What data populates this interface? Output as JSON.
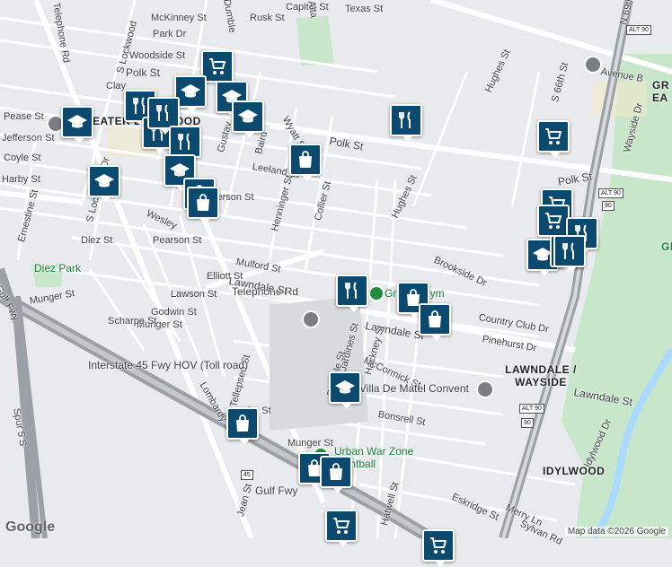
{
  "map": {
    "street_labels": [
      "Telephone Rd",
      "S Lockwood",
      "McKinney St",
      "Rusk St",
      "Capitol St",
      "Texas St",
      "Dumble",
      "Alta",
      "Park Dr",
      "Woodside St",
      "Polk St",
      "Clay",
      "Pease St",
      "Jefferson St",
      "Coyle St",
      "Harby St",
      "Ernestine St",
      "S Lockwood Dr",
      "Diez St",
      "Munger St",
      "Gustav",
      "Baird",
      "Leeland St",
      "Henninger St",
      "Collier St",
      "Wyatt St",
      "Polk St",
      "Polk St",
      "Hughes St",
      "Hughes St",
      "Hughes St",
      "S 66th St",
      "Avenue B",
      "Wayside Dr",
      "Wesley",
      "Jefferson St",
      "Pearson St",
      "Elliott St",
      "Lawson St",
      "Godwin St",
      "Munger St",
      "Scharpe St",
      "Lombardy St",
      "Telephone Rd",
      "Mulford St",
      "Lawndale St",
      "Brookside Dr",
      "Country Club Dr",
      "Pinehurst Dr",
      "Lawndale St",
      "Lawndale St",
      "McCormick St",
      "Bonsrell St",
      "Jardines St",
      "Hackney St",
      "Dumble St",
      "Tellepsen St",
      "Interstate 45 Fwy HOV (Toll road)",
      "Gulf Fwy",
      "Gulf Fwy",
      "Spur 5 S",
      "Jean St",
      "Munger St",
      "Hatwell St",
      "Eskridge St",
      "Merry Ln",
      "Sylvan Rd",
      "Idylwood Dr",
      "N 69th St",
      "ire St",
      "Ca",
      "N"
    ],
    "area_labels": [
      "GREATER EASTWOOD",
      "LAWNDALE / WAYSIDE",
      "IDYLWOOD",
      "GR EA",
      "Gl"
    ],
    "poi_labels": {
      "park": "Diez Park",
      "gym": "Gravity Gym",
      "convent": "Villa De Matel Convent",
      "paintball": "Urban War Zone Paintball"
    },
    "highway_shields": [
      "ALT 90",
      "ALT 90",
      "ALT 90",
      "90",
      "90",
      "45"
    ],
    "pins": [
      {
        "type": "shopping-cart",
        "label": "grocery"
      },
      {
        "type": "graduation-cap",
        "label": "school"
      },
      {
        "type": "graduation-cap",
        "label": "school"
      },
      {
        "type": "graduation-cap",
        "label": "school"
      },
      {
        "type": "graduation-cap",
        "label": "school"
      },
      {
        "type": "fork-knife",
        "label": "restaurant"
      },
      {
        "type": "fork-knife",
        "label": "restaurant"
      },
      {
        "type": "fork-knife",
        "label": "restaurant"
      },
      {
        "type": "fork-knife",
        "label": "restaurant"
      },
      {
        "type": "graduation-cap",
        "label": "school"
      },
      {
        "type": "graduation-cap",
        "label": "school"
      },
      {
        "type": "shopping-bag",
        "label": "store"
      },
      {
        "type": "shopping-bag",
        "label": "store"
      },
      {
        "type": "fork-knife",
        "label": "restaurant"
      },
      {
        "type": "shopping-bag",
        "label": "store"
      },
      {
        "type": "shopping-cart",
        "label": "grocery"
      },
      {
        "type": "shopping-cart",
        "label": "grocery"
      },
      {
        "type": "shopping-cart",
        "label": "grocery"
      },
      {
        "type": "fork-knife",
        "label": "restaurant"
      },
      {
        "type": "graduation-cap",
        "label": "school"
      },
      {
        "type": "graduation-cap",
        "label": "school"
      },
      {
        "type": "fork-knife",
        "label": "restaurant"
      },
      {
        "type": "fork-knife",
        "label": "restaurant"
      },
      {
        "type": "shopping-bag",
        "label": "store"
      },
      {
        "type": "shopping-bag",
        "label": "store"
      },
      {
        "type": "graduation-cap",
        "label": "school"
      },
      {
        "type": "shopping-bag",
        "label": "store"
      },
      {
        "type": "shopping-bag",
        "label": "store"
      },
      {
        "type": "shopping-bag",
        "label": "store"
      },
      {
        "type": "shopping-cart",
        "label": "grocery"
      },
      {
        "type": "shopping-cart",
        "label": "grocery"
      }
    ],
    "footer": {
      "logo": "Google",
      "attribution": "Map data ©2026 Google"
    }
  },
  "colors": {
    "pin": "#0b4a6e",
    "water": "#aadaff",
    "park": "#c8e6c9",
    "freeway": "#9aa0a6",
    "road": "#ffffff",
    "background": "#e8eaed"
  }
}
